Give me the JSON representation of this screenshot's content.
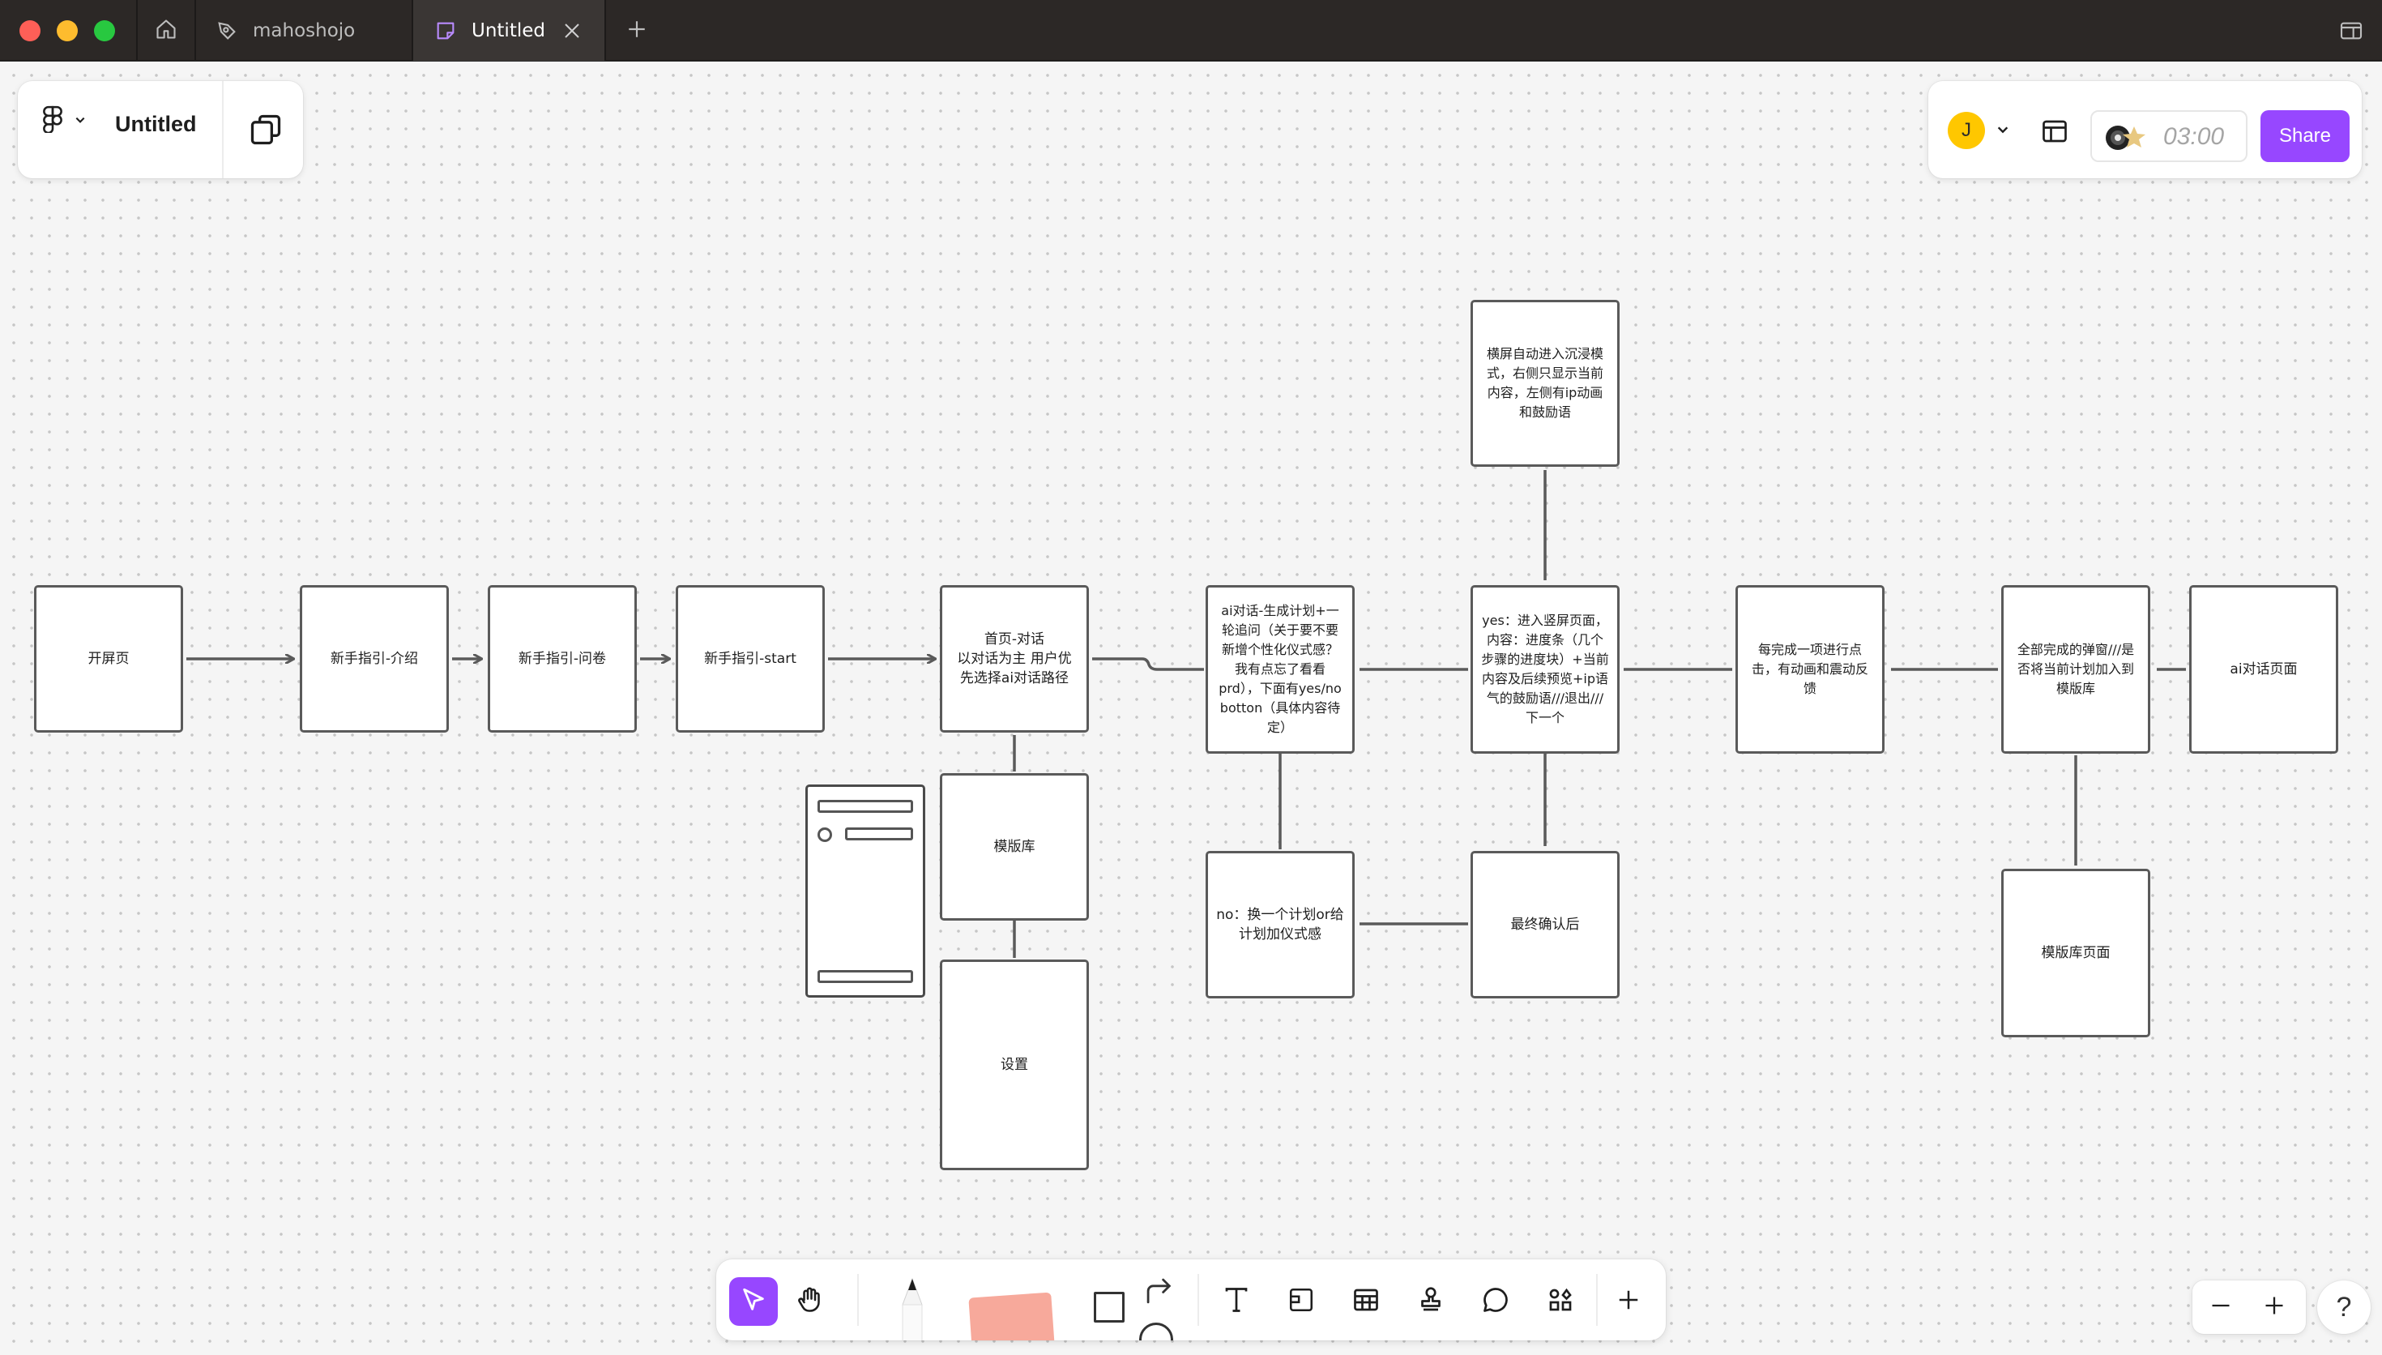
{
  "window": {
    "tabs": [
      {
        "label": "mahoshojo",
        "icon": "figjam-logo-icon",
        "active": false
      },
      {
        "label": "Untitled",
        "icon": "board-file-icon",
        "active": true
      }
    ]
  },
  "header": {
    "file_title": "Untitled"
  },
  "collab": {
    "avatar_initial": "J",
    "avatar_color": "#ffc700",
    "timer": "03:00",
    "share_label": "Share",
    "accent": "#9747ff"
  },
  "diagram": {
    "nodes": {
      "splash": "开屏页",
      "guide_intro": "新手指引-介绍",
      "guide_survey": "新手指引-问卷",
      "guide_start": "新手指引-start",
      "home_chat": "首页-对话\n以对话为主 用户优先选择ai对话路径",
      "template_lib": "模版库",
      "settings": "设置",
      "ai_plan": "ai对话-生成计划+一轮追问（关于要不要新增个性化仪式感？我有点忘了看看prd），下面有yes/no botton（具体内容待定）",
      "no_branch": "no：换一个计划or给计划加仪式感",
      "landscape": "横屏自动进入沉浸模式，右侧只显示当前内容，左侧有ip动画和鼓励语",
      "yes_branch": "yes：进入竖屏页面，内容：进度条（几个步骤的进度块）+当前内容及后续预览+ip语气的鼓励语///退出///下一个",
      "final_confirm": "最终确认后",
      "each_done": "每完成一项进行点击，有动画和震动反馈",
      "all_done": "全部完成的弹窗///是否将当前计划加入到模版库",
      "ai_chat_page": "ai对话页面",
      "template_page": "模版库页面"
    }
  },
  "toolbar": {
    "tools": [
      "move",
      "hand",
      "pencil",
      "sticky-note",
      "shapes",
      "text",
      "section",
      "table",
      "stamp",
      "comment",
      "more-apps",
      "plus"
    ],
    "sticky_color": "#f7a99b"
  },
  "zoom": {
    "help": "?"
  }
}
